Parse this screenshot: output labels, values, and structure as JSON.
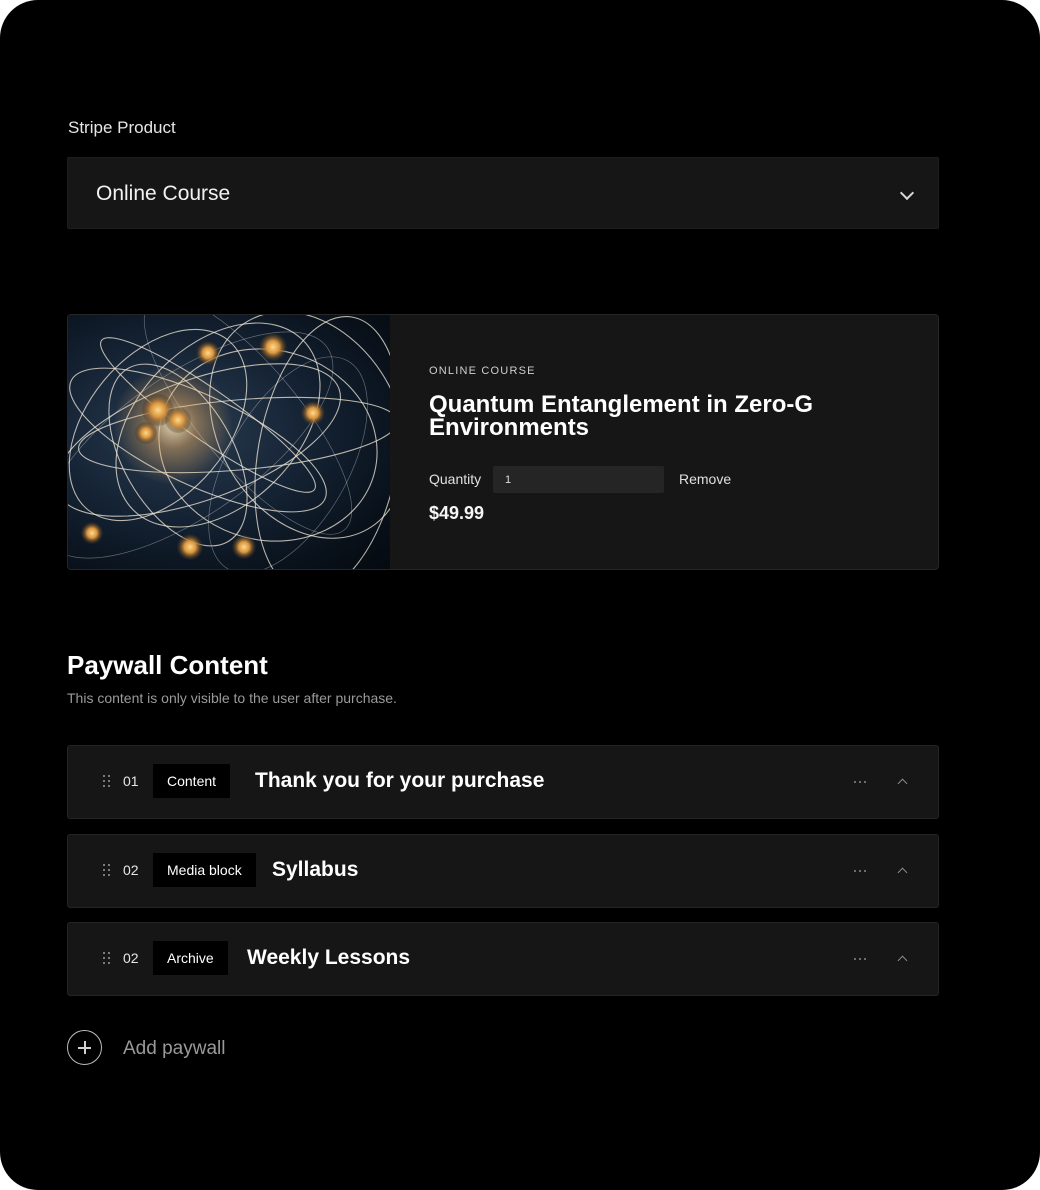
{
  "stripe_product": {
    "label": "Stripe Product",
    "selected": "Online Course"
  },
  "product": {
    "eyebrow": "ONLINE COURSE",
    "title": "Quantum Entanglement in Zero-G Environments",
    "quantity_label": "Quantity",
    "quantity_value": "1",
    "remove_label": "Remove",
    "price": "$49.99"
  },
  "paywall": {
    "title": "Paywall Content",
    "subtitle": "This content is only visible to the user after purchase.",
    "items": [
      {
        "number": "01",
        "type": "Content",
        "title": "Thank you for your purchase"
      },
      {
        "number": "02",
        "type": "Media block",
        "title": "Syllabus"
      },
      {
        "number": "02",
        "type": "Archive",
        "title": "Weekly Lessons"
      }
    ],
    "add_label": "Add paywall"
  },
  "icons": {
    "select_chevron": "chevron-down-icon",
    "drag": "drag-handle-icon",
    "more": "more-horizontal-icon",
    "collapse": "chevron-up-icon",
    "add": "plus-circle-icon"
  }
}
